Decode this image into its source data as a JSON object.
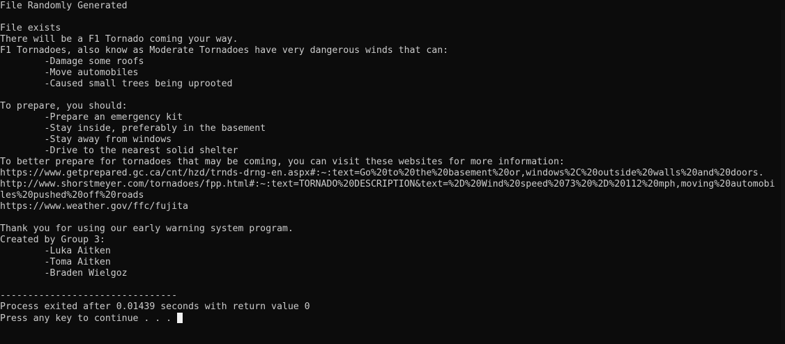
{
  "console": {
    "lines": [
      "File Randomly Generated",
      "",
      "File exists",
      "There will be a F1 Tornado coming your way.",
      "F1 Tornadoes, also know as Moderate Tornadoes have very dangerous winds that can:",
      "        -Damage some roofs",
      "        -Move automobiles",
      "        -Caused small trees being uprooted",
      "",
      "To prepare, you should:",
      "        -Prepare an emergency kit",
      "        -Stay inside, preferably in the basement",
      "        -Stay away from windows",
      "        -Drive to the nearest solid shelter",
      "To better prepare for tornadoes that may be coming, you can visit these websites for more information:",
      "https://www.getprepared.gc.ca/cnt/hzd/trnds-drng-en.aspx#:~:text=Go%20to%20the%20basement%20or,windows%2C%20outside%20walls%20and%20doors.",
      "http://www.shorstmeyer.com/tornadoes/fpp.html#:~:text=TORNADO%20DESCRIPTION&text=%2D%20Wind%20speed%2073%20%2D%20112%20mph,moving%20automobi",
      "les%20pushed%20off%20roads",
      "https://www.weather.gov/ffc/fujita",
      "",
      "Thank you for using our early warning system program.",
      "Created by Group 3:",
      "        -Luka Aitken",
      "        -Toma Aitken",
      "        -Braden Wielgoz",
      "",
      "--------------------------------",
      "Process exited after 0.01439 seconds with return value 0",
      "Press any key to continue . . . "
    ]
  },
  "colors": {
    "background": "#0c0c0c",
    "text": "#cccccc",
    "cursor": "#f2f2f2"
  }
}
